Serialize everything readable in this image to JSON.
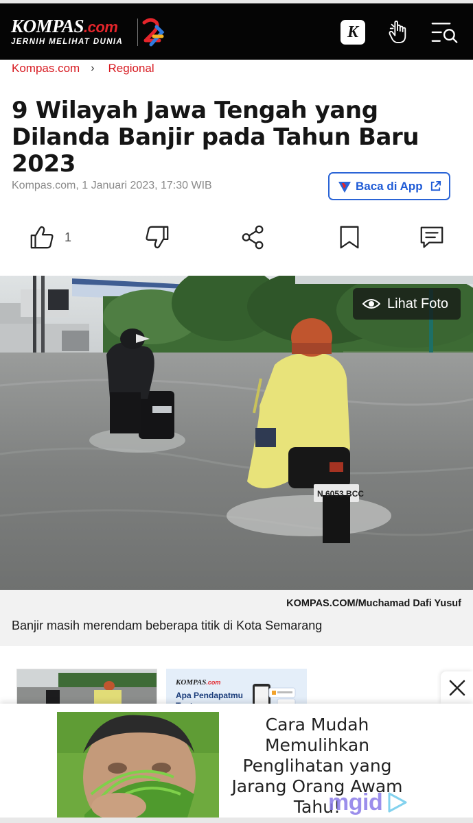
{
  "header": {
    "logo_main": "KOMPAS",
    "logo_dotcom": ".com",
    "logo_tagline": "JERNIH MELIHAT DUNIA",
    "k_letter": "K",
    "icons": [
      "kompas-k-app-icon",
      "pointing-hand-icon",
      "menu-search-icon"
    ]
  },
  "breadcrumb": {
    "items": [
      "Kompas.com",
      "Regional"
    ],
    "separator": "›"
  },
  "article": {
    "title": "9 Wilayah Jawa Tengah yang Dilanda Banjir pada Tahun Baru 2023",
    "byline": "Kompas.com, 1 Januari 2023, 17:30 WIB",
    "app_button": "Baca di App",
    "like_count": "1"
  },
  "photo": {
    "view_button": "Lihat Foto",
    "credit": "KOMPAS.COM/Muchamad Dafi Yusuf",
    "caption": "Banjir masih merendam beberapa titik di Kota Semarang",
    "plate": "N 6053 BCC"
  },
  "related": {
    "thumb2_logo_main": "KOMPAS",
    "thumb2_logo_dotcom": ".com",
    "thumb2_text": "Apa Pendapatmu Tentang"
  },
  "ad": {
    "text": "Cara Mudah Memulihkan Penglihatan yang Jarang Orang Awam Tahu!",
    "brand": "mgid"
  },
  "colors": {
    "brand_red": "#d71920",
    "header_bg": "#050505",
    "app_blue": "#1f5bd6"
  }
}
